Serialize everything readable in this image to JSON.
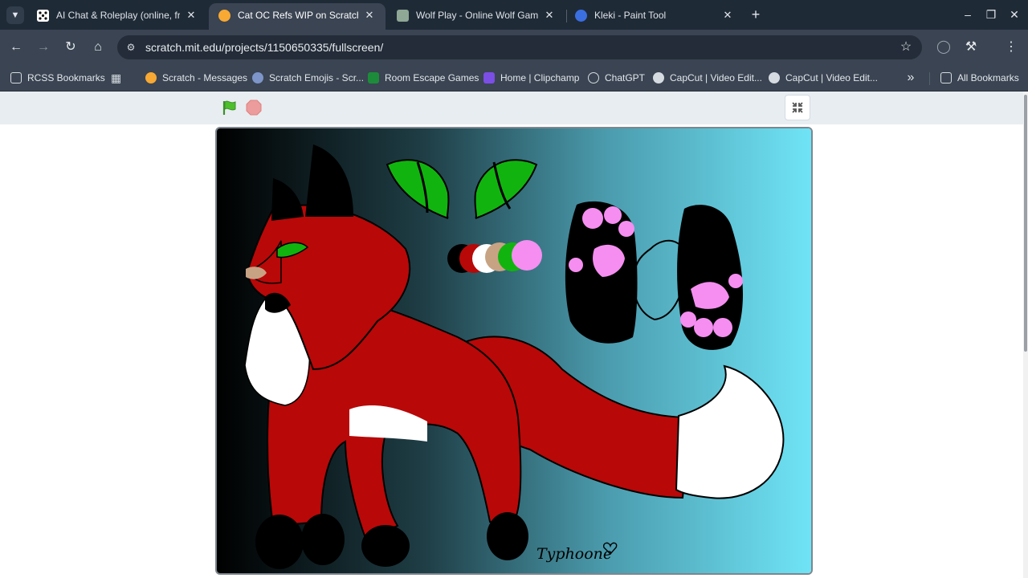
{
  "browser": {
    "tabs": [
      {
        "title": "AI Chat & Roleplay (online, free",
        "icon": "dice-icon",
        "active": false
      },
      {
        "title": "Cat OC Refs WIP on Scratch",
        "icon": "scratch-icon",
        "active": true
      },
      {
        "title": "Wolf Play - Online Wolf Game!",
        "icon": "wolf-play-icon",
        "active": false
      },
      {
        "title": "Kleki - Paint Tool",
        "icon": "kleki-icon",
        "active": false
      }
    ],
    "url": "scratch.mit.edu/projects/1150650335/fullscreen/",
    "bookmarks": [
      {
        "label": "RCSS Bookmarks",
        "icon": "folder-icon"
      },
      {
        "label": "",
        "icon": "apps-grid-icon"
      },
      {
        "label": "Scratch - Messages",
        "icon": "scratch-icon"
      },
      {
        "label": "Scratch Emojis - Scr...",
        "icon": "scratch-emojis-icon"
      },
      {
        "label": "Room Escape Games",
        "icon": "puzzle-icon"
      },
      {
        "label": "Home | Clipchamp",
        "icon": "clipchamp-icon"
      },
      {
        "label": "ChatGPT",
        "icon": "chatgpt-icon"
      },
      {
        "label": "CapCut | Video Edit...",
        "icon": "capcut-icon"
      },
      {
        "label": "CapCut | Video Edit...",
        "icon": "capcut-icon"
      }
    ],
    "all_bookmarks_label": "All Bookmarks"
  },
  "stage": {
    "signature": "Typhoone",
    "colors": {
      "fur_red": "#b80808",
      "white": "#ffffff",
      "black": "#000000",
      "eye_green": "#11b40f",
      "paw_pink": "#f58ef0",
      "nose_tan": "#c7a384",
      "bg_left": "#000000",
      "bg_right": "#6fe4f6"
    },
    "palette": [
      "#000000",
      "#b80808",
      "#ffffff",
      "#c7a384",
      "#11b40f",
      "#f58ef0"
    ]
  }
}
